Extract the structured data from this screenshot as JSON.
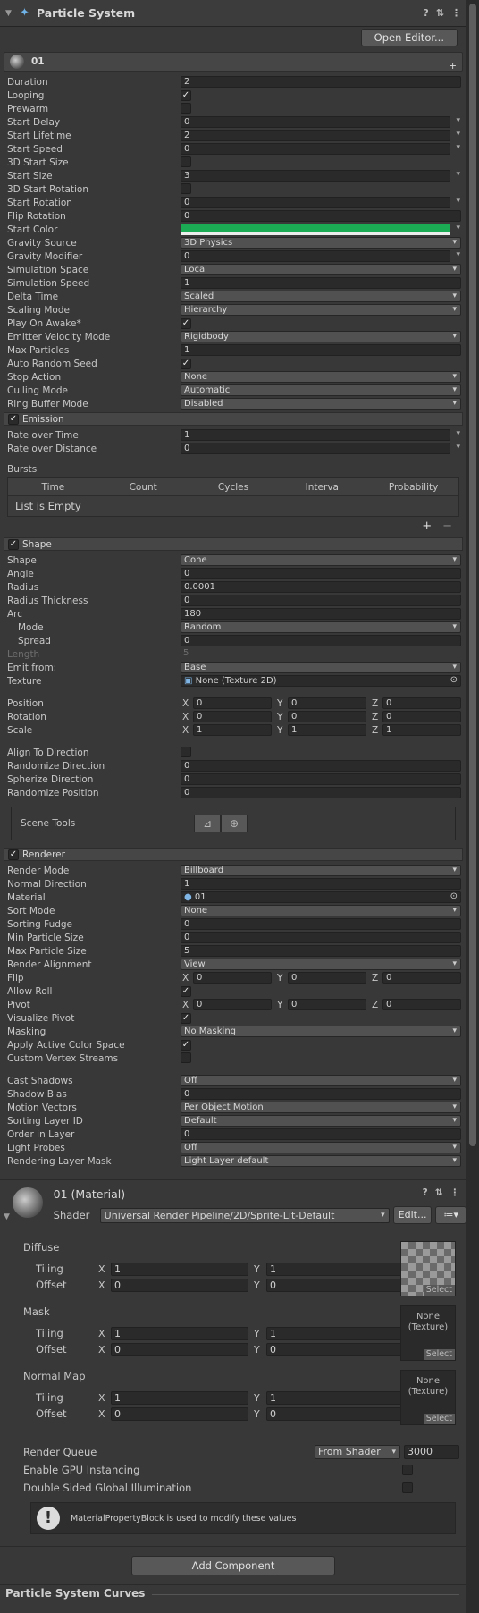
{
  "header": {
    "title": "Particle System"
  },
  "open_editor": "Open Editor...",
  "module": {
    "name": "01",
    "plus": "+"
  },
  "main_rows": [
    {
      "label": "Duration",
      "type": "field",
      "value": "2"
    },
    {
      "label": "Looping",
      "type": "check",
      "value": "✓"
    },
    {
      "label": "Prewarm",
      "type": "check",
      "value": ""
    },
    {
      "label": "Start Delay",
      "type": "fieldarrow",
      "value": "0"
    },
    {
      "label": "Start Lifetime",
      "type": "fieldarrow",
      "value": "2"
    },
    {
      "label": "Start Speed",
      "type": "fieldarrow",
      "value": "0"
    },
    {
      "label": "3D Start Size",
      "type": "check",
      "value": ""
    },
    {
      "label": "Start Size",
      "type": "fieldarrow",
      "value": "3"
    },
    {
      "label": "3D Start Rotation",
      "type": "check",
      "value": ""
    },
    {
      "label": "Start Rotation",
      "type": "fieldarrow",
      "value": "0"
    },
    {
      "label": "Flip Rotation",
      "type": "field",
      "value": "0"
    },
    {
      "label": "Start Color",
      "type": "color",
      "value": "#1bab54"
    },
    {
      "label": "Gravity Source",
      "type": "drop",
      "value": "3D Physics"
    },
    {
      "label": "Gravity Modifier",
      "type": "fieldarrow",
      "value": "0"
    },
    {
      "label": "Simulation Space",
      "type": "drop",
      "value": "Local"
    },
    {
      "label": "Simulation Speed",
      "type": "field",
      "value": "1"
    },
    {
      "label": "Delta Time",
      "type": "drop",
      "value": "Scaled"
    },
    {
      "label": "Scaling Mode",
      "type": "drop",
      "value": "Hierarchy"
    },
    {
      "label": "Play On Awake*",
      "type": "check",
      "value": "✓"
    },
    {
      "label": "Emitter Velocity Mode",
      "type": "drop",
      "value": "Rigidbody"
    },
    {
      "label": "Max Particles",
      "type": "field",
      "value": "1"
    },
    {
      "label": "Auto Random Seed",
      "type": "check",
      "value": "✓"
    },
    {
      "label": "Stop Action",
      "type": "drop",
      "value": "None"
    },
    {
      "label": "Culling Mode",
      "type": "drop",
      "value": "Automatic"
    },
    {
      "label": "Ring Buffer Mode",
      "type": "drop",
      "value": "Disabled"
    }
  ],
  "emission": {
    "title": "Emission",
    "rows": [
      {
        "label": "Rate over Time",
        "type": "fieldarrow",
        "value": "1"
      },
      {
        "label": "Rate over Distance",
        "type": "fieldarrow",
        "value": "0"
      }
    ],
    "bursts_label": "Bursts",
    "columns": [
      "Time",
      "Count",
      "Cycles",
      "Interval",
      "Probability"
    ],
    "empty": "List is Empty",
    "plus": "+",
    "minus": "−"
  },
  "shape": {
    "title": "Shape",
    "rows": [
      {
        "label": "Shape",
        "type": "drop",
        "value": "Cone"
      },
      {
        "label": "Angle",
        "type": "field",
        "value": "0"
      },
      {
        "label": "Radius",
        "type": "field",
        "value": "0.0001"
      },
      {
        "label": "Radius Thickness",
        "type": "field",
        "value": "0"
      },
      {
        "label": "Arc",
        "type": "field",
        "value": "180"
      },
      {
        "label": "Mode",
        "type": "drop",
        "value": "Random",
        "indent": true
      },
      {
        "label": "Spread",
        "type": "field",
        "value": "0",
        "indent": true
      },
      {
        "label": "Length",
        "type": "dimfield",
        "value": "5"
      },
      {
        "label": "Emit from:",
        "type": "drop",
        "value": "Base"
      },
      {
        "label": "Texture",
        "type": "obj",
        "value": "None (Texture 2D)"
      }
    ],
    "transform": [
      {
        "label": "Position",
        "x": "0",
        "y": "0",
        "z": "0"
      },
      {
        "label": "Rotation",
        "x": "0",
        "y": "0",
        "z": "0"
      },
      {
        "label": "Scale",
        "x": "1",
        "y": "1",
        "z": "1"
      }
    ],
    "rows2": [
      {
        "label": "Align To Direction",
        "type": "check",
        "value": ""
      },
      {
        "label": "Randomize Direction",
        "type": "field",
        "value": "0"
      },
      {
        "label": "Spherize Direction",
        "type": "field",
        "value": "0"
      },
      {
        "label": "Randomize Position",
        "type": "field",
        "value": "0"
      }
    ],
    "scene_tools": "Scene Tools"
  },
  "renderer": {
    "title": "Renderer",
    "rows": [
      {
        "label": "Render Mode",
        "type": "drop",
        "value": "Billboard"
      },
      {
        "label": "Normal Direction",
        "type": "field",
        "value": "1"
      },
      {
        "label": "Material",
        "type": "obj",
        "value": "01"
      },
      {
        "label": "Sort Mode",
        "type": "drop",
        "value": "None"
      },
      {
        "label": "Sorting Fudge",
        "type": "field",
        "value": "0"
      },
      {
        "label": "Min Particle Size",
        "type": "field",
        "value": "0"
      },
      {
        "label": "Max Particle Size",
        "type": "field",
        "value": "5"
      },
      {
        "label": "Render Alignment",
        "type": "drop",
        "value": "View"
      }
    ],
    "flip": {
      "label": "Flip",
      "x": "0",
      "y": "0",
      "z": "0"
    },
    "allow_roll": {
      "label": "Allow Roll",
      "value": "✓"
    },
    "pivot": {
      "label": "Pivot",
      "x": "0",
      "y": "0",
      "z": "0"
    },
    "rows2": [
      {
        "label": "Visualize Pivot",
        "type": "check",
        "value": "✓"
      },
      {
        "label": "Masking",
        "type": "drop",
        "value": "No Masking"
      },
      {
        "label": "Apply Active Color Space",
        "type": "check",
        "value": "✓"
      },
      {
        "label": "Custom Vertex Streams",
        "type": "check",
        "value": ""
      }
    ],
    "rows3": [
      {
        "label": "Cast Shadows",
        "type": "drop",
        "value": "Off"
      },
      {
        "label": "Shadow Bias",
        "type": "field",
        "value": "0"
      },
      {
        "label": "Motion Vectors",
        "type": "drop",
        "value": "Per Object Motion"
      },
      {
        "label": "Sorting Layer ID",
        "type": "drop",
        "value": "Default"
      },
      {
        "label": "Order in Layer",
        "type": "field",
        "value": "0"
      },
      {
        "label": "Light Probes",
        "type": "drop",
        "value": "Off"
      },
      {
        "label": "Rendering Layer Mask",
        "type": "drop",
        "value": "Light Layer default"
      }
    ]
  },
  "material": {
    "title": "01 (Material)",
    "shader_label": "Shader",
    "shader_value": "Universal Render Pipeline/2D/Sprite-Lit-Default",
    "edit": "Edit...",
    "groups": [
      {
        "name": "Diffuse",
        "tiling_x": "1",
        "tiling_y": "1",
        "offset_x": "0",
        "offset_y": "0",
        "tex": "",
        "select": "Select"
      },
      {
        "name": "Mask",
        "tiling_x": "1",
        "tiling_y": "1",
        "offset_x": "0",
        "offset_y": "0",
        "tex": "None\n(Texture)",
        "select": "Select"
      },
      {
        "name": "Normal Map",
        "tiling_x": "1",
        "tiling_y": "1",
        "offset_x": "0",
        "offset_y": "0",
        "tex": "None\n(Texture)",
        "select": "Select"
      }
    ],
    "tiling": "Tiling",
    "offset": "Offset",
    "x": "X",
    "y": "Y",
    "render_queue": "Render Queue",
    "render_queue_mode": "From Shader",
    "render_queue_value": "3000",
    "gpu_instancing": "Enable GPU Instancing",
    "double_sided": "Double Sided Global Illumination",
    "help": "MaterialPropertyBlock is used to modify these values"
  },
  "add_component": "Add Component",
  "curves": "Particle System Curves"
}
